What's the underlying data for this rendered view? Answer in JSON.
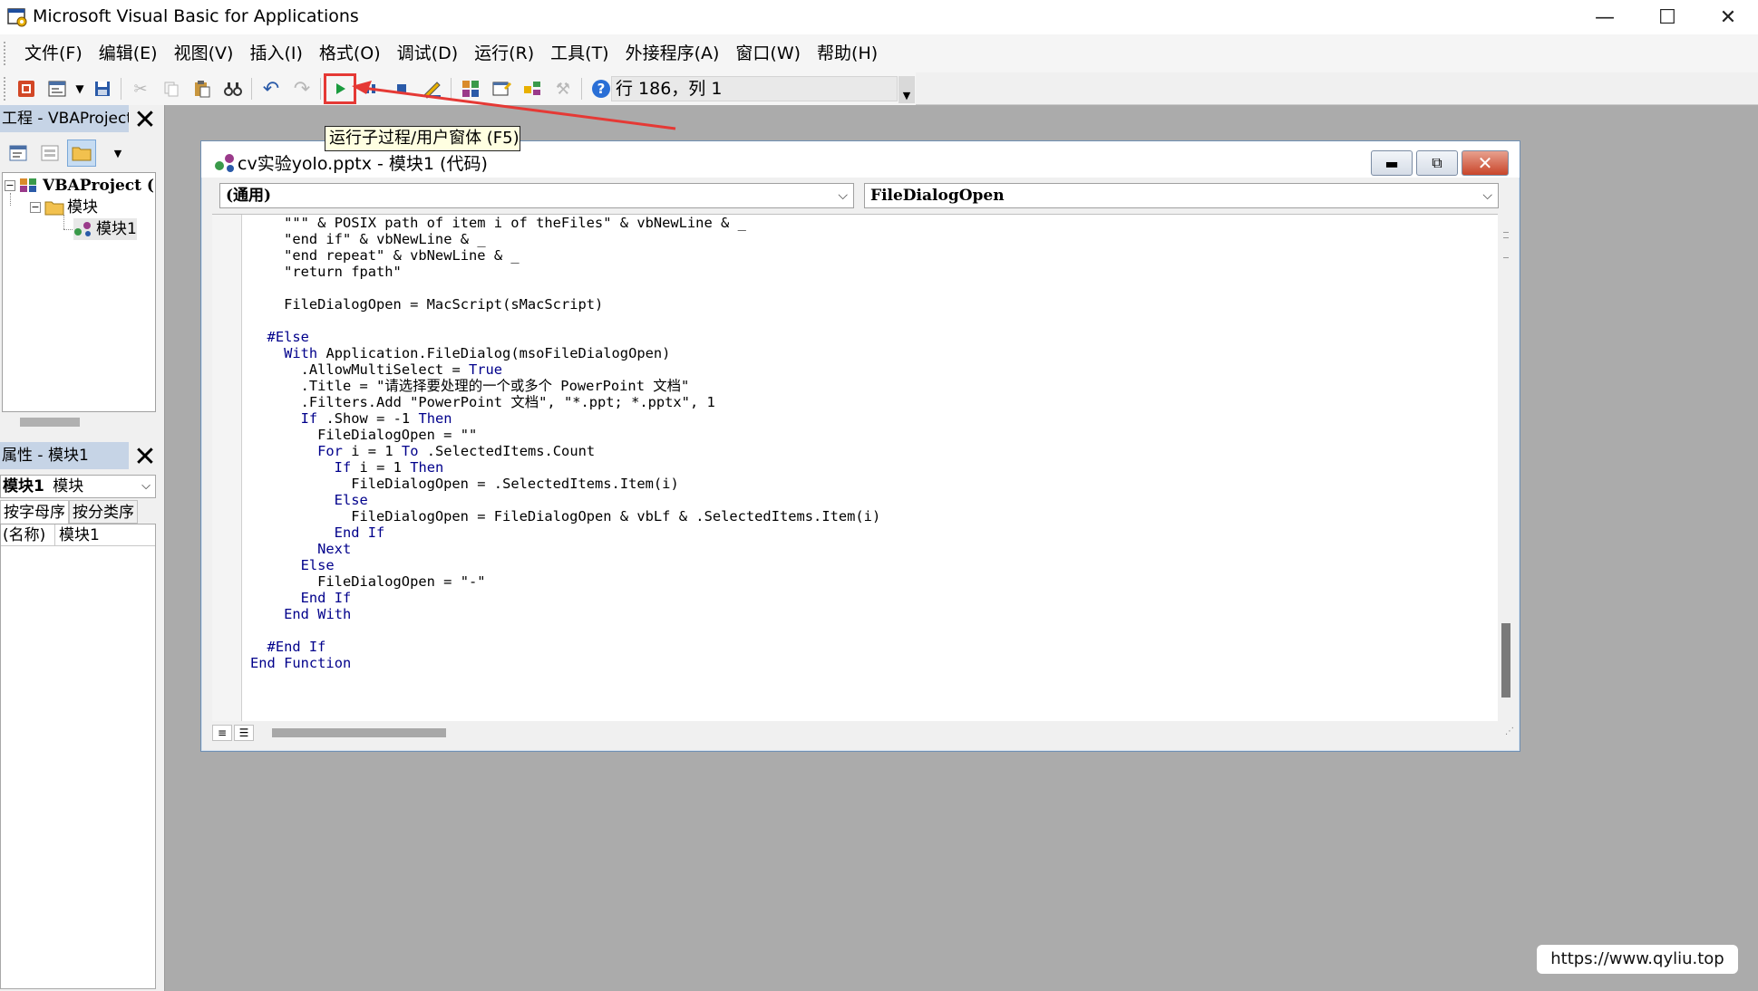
{
  "window": {
    "title": "Microsoft Visual Basic for Applications",
    "minimize_glyph": "—",
    "maximize_glyph": "☐",
    "close_glyph": "✕"
  },
  "menu": [
    "文件(F)",
    "编辑(E)",
    "视图(V)",
    "插入(I)",
    "格式(O)",
    "调试(D)",
    "运行(R)",
    "工具(T)",
    "外接程序(A)",
    "窗口(W)",
    "帮助(H)"
  ],
  "toolbar": {
    "status": "行 186，列 1",
    "run_tooltip": "运行子过程/用户窗体 (F5)",
    "run_color": "#1a9b3e",
    "highlight_color": "#e53935"
  },
  "project_panel": {
    "title": "工程 - VBAProject",
    "tree": {
      "root": "VBAProject (",
      "folder": "模块",
      "module": "模块1"
    }
  },
  "properties_panel": {
    "title": "属性 - 模块1",
    "object_name": "模块1",
    "object_type": "模块",
    "tabs": [
      "按字母序",
      "按分类序"
    ],
    "rows": [
      {
        "key": "(名称)",
        "value": "模块1"
      }
    ]
  },
  "code_window": {
    "title": "cv实验yolo.pptx - 模块1 (代码)",
    "object_combo": "(通用)",
    "procedure_combo": "FileDialogOpen",
    "lines": [
      "    \"\"\" & POSIX path of item i of theFiles\" & vbNewLine & _",
      "    \"end if\" & vbNewLine & _",
      "    \"end repeat\" & vbNewLine & _",
      "    \"return fpath\"",
      "",
      "    FileDialogOpen = MacScript(sMacScript)",
      "",
      "  #Else",
      "    With Application.FileDialog(msoFileDialogOpen)",
      "      .AllowMultiSelect = True",
      "      .Title = \"请选择要处理的一个或多个 PowerPoint 文档\"",
      "      .Filters.Add \"PowerPoint 文档\", \"*.ppt; *.pptx\", 1",
      "      If .Show = -1 Then",
      "        FileDialogOpen = \"\"",
      "        For i = 1 To .SelectedItems.Count",
      "          If i = 1 Then",
      "            FileDialogOpen = .SelectedItems.Item(i)",
      "          Else",
      "            FileDialogOpen = FileDialogOpen & vbLf & .SelectedItems.Item(i)",
      "          End If",
      "        Next",
      "      Else",
      "        FileDialogOpen = \"-\"",
      "      End If",
      "    End With",
      "",
      "  #End If",
      "End Function"
    ],
    "keywords": [
      "#Else",
      "With",
      "True",
      "If",
      "Then",
      "For",
      "To",
      "Else",
      "End",
      "Next",
      "#End",
      "Function"
    ],
    "keyword_color": "#00008b"
  },
  "watermark": "https://www.qyliu.top"
}
